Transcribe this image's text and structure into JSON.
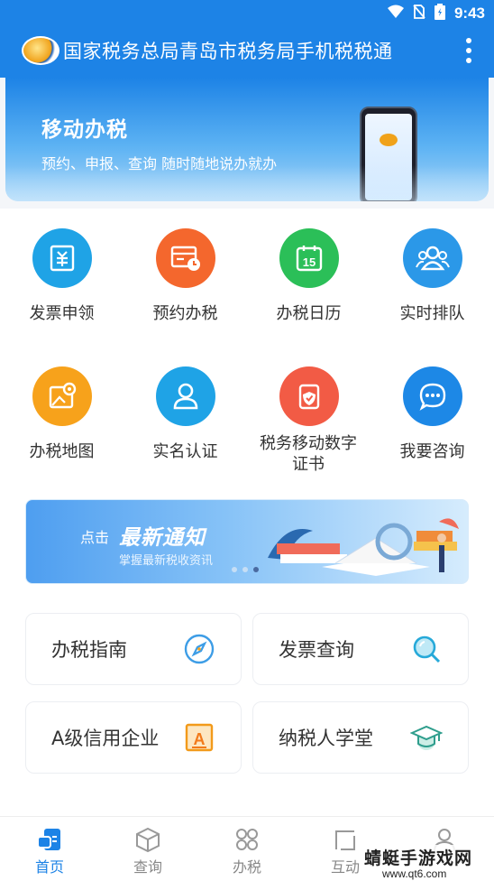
{
  "status_bar": {
    "time": "9:43"
  },
  "app_bar": {
    "title": "国家税务总局青岛市税务局手机税税通",
    "menu_icon": "more-vertical-icon"
  },
  "banner": {
    "title": "移动办税",
    "subtitle": "预约、申报、查询 随时随地说办就办"
  },
  "grid": [
    {
      "label": "发票申领",
      "icon": "invoice-icon",
      "color": "#1fa3e6"
    },
    {
      "label": "预约办税",
      "icon": "appointment-icon",
      "color": "#f4672d"
    },
    {
      "label": "办税日历",
      "icon": "calendar-icon",
      "color": "#2bbf58"
    },
    {
      "label": "实时排队",
      "icon": "queue-icon",
      "color": "#2b98e8"
    },
    {
      "label": "办税地图",
      "icon": "map-icon",
      "color": "#f7a21b"
    },
    {
      "label": "实名认证",
      "icon": "person-icon",
      "color": "#1fa3e6"
    },
    {
      "label": "税务移动数字证书",
      "icon": "certificate-shield-icon",
      "color": "#f25b45"
    },
    {
      "label": "我要咨询",
      "icon": "chat-icon",
      "color": "#1d88e6"
    }
  ],
  "notice": {
    "click_label": "点击",
    "title": "最新通知",
    "subtitle": "掌握最新税收资讯",
    "carousel": {
      "count": 3,
      "active": 3
    }
  },
  "services": [
    {
      "label": "办税指南",
      "icon": "compass-icon"
    },
    {
      "label": "发票查询",
      "icon": "search-icon"
    },
    {
      "label": "A级信用企业",
      "icon": "credit-a-icon"
    },
    {
      "label": "纳税人学堂",
      "icon": "graduation-cap-icon"
    }
  ],
  "tabs": [
    {
      "label": "首页",
      "icon": "home-icon",
      "active": true
    },
    {
      "label": "查询",
      "icon": "cube-icon"
    },
    {
      "label": "办税",
      "icon": "apps-grid-icon"
    },
    {
      "label": "互动",
      "icon": "interaction-icon"
    },
    {
      "label": "",
      "icon": "user-icon"
    }
  ],
  "watermark": {
    "line1": "蜻蜓手游戏网",
    "line2": "www.qt6.com"
  },
  "colors": {
    "primary": "#1d83e6",
    "tab_active": "#1d83e6",
    "tab_inactive": "#888888"
  }
}
